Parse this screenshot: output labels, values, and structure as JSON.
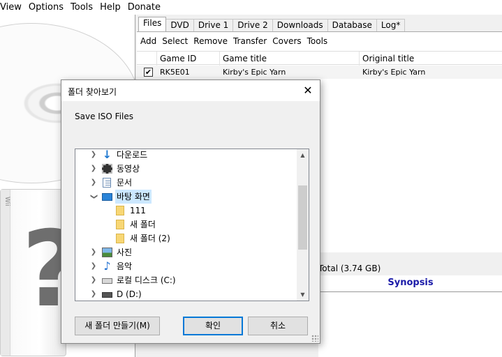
{
  "menu": {
    "items": [
      "View",
      "Options",
      "Tools",
      "Help",
      "Donate"
    ]
  },
  "tabs": [
    "Files",
    "DVD",
    "Drive 1",
    "Drive 2",
    "Downloads",
    "Database",
    "Log*"
  ],
  "toolbar": [
    "Add",
    "Select",
    "Remove",
    "Transfer",
    "Covers",
    "Tools"
  ],
  "grid": {
    "columns": [
      "Game ID",
      "Game title",
      "Original title"
    ],
    "rows": [
      {
        "checked": "✔",
        "id": "RK5E01",
        "title": "Kirby's Epic Yarn",
        "original": "Kirby's Epic Yarn"
      }
    ]
  },
  "wii_box_label": "Wii",
  "total": "Total (3.74 GB)",
  "synopsis": "Synopsis",
  "dialog": {
    "title": "폴더 찾아보기",
    "label": "Save ISO Files",
    "tree": [
      {
        "label": "다운로드",
        "icon": "download-icon"
      },
      {
        "label": "동영상",
        "icon": "video-folder-icon"
      },
      {
        "label": "문서",
        "icon": "document-icon"
      },
      {
        "label": "바탕 화면",
        "icon": "desktop-icon"
      },
      {
        "label": "111",
        "icon": "folder-icon"
      },
      {
        "label": "새 폴더",
        "icon": "folder-icon"
      },
      {
        "label": "새 폴더 (2)",
        "icon": "folder-icon"
      },
      {
        "label": "사진",
        "icon": "picture-icon"
      },
      {
        "label": "음악",
        "icon": "music-icon"
      },
      {
        "label": "로컬 디스크 (C:)",
        "icon": "local-disk-icon"
      },
      {
        "label": "D (D:)",
        "icon": "drive-icon"
      }
    ],
    "buttons": {
      "new_folder": "새 폴더 만들기(M)",
      "ok": "확인",
      "cancel": "취소"
    }
  },
  "colors": {
    "selection": "#cce8ff",
    "synopsis_text": "#1a1aa8",
    "default_button": "#0078d7"
  }
}
